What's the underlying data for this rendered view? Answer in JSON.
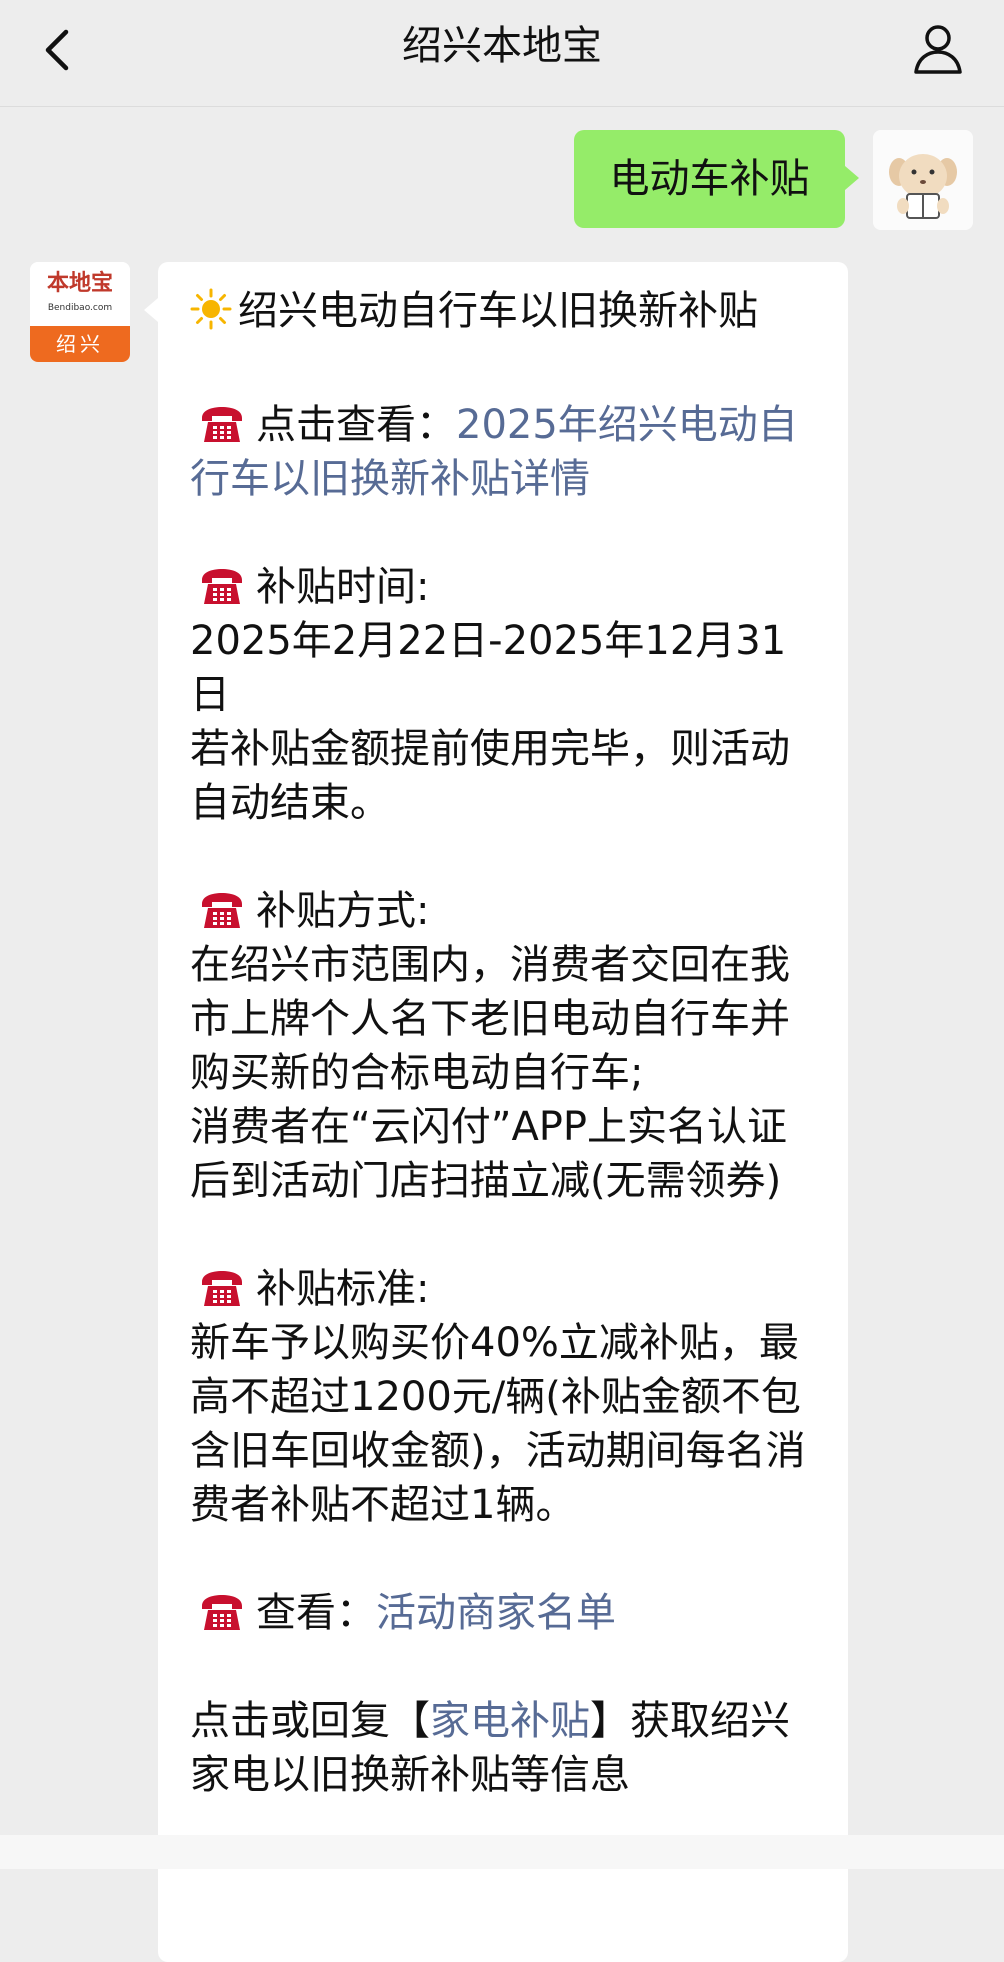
{
  "nav": {
    "title": "绍兴本地宝"
  },
  "outgoing_message": "电动车补贴",
  "bot_avatar": {
    "logo_text": "本地宝",
    "logo_sub": "Bendibao.com",
    "city": "绍兴"
  },
  "incoming": {
    "title": "绍兴电动自行车以旧换新补贴",
    "view_detail_prefix": "点击查看：",
    "view_detail_link": "2025年绍兴电动自行车以旧换新补贴详情",
    "time_heading": "补贴时间:",
    "time_text": "2025年2月22日-2025年12月31日",
    "time_note": "若补贴金额提前使用完毕，则活动自动结束。",
    "method_heading": "补贴方式:",
    "method_text_1": "在绍兴市范围内，消费者交回在我市上牌个人名下老旧电动自行车并购买新的合标电动自行车;",
    "method_text_2": "消费者在“云闪付”APP上实名认证后到活动门店扫描立减(无需领券)",
    "standard_heading": "补贴标准:",
    "standard_text": "新车予以购买价40%立减补贴，最高不超过1200元/辆(补贴金额不包含旧车回收金额)，活动期间每名消费者补贴不超过1辆。",
    "merchant_prefix": "查看：",
    "merchant_link": "活动商家名单",
    "reply_prefix": "点击或回复【",
    "reply_link": "家电补贴",
    "reply_suffix": "】获取绍兴家电以旧换新补贴等信息"
  },
  "colors": {
    "background": "#ededed",
    "outgoing_bubble": "#95ec69",
    "incoming_bubble": "#ffffff",
    "link": "#576b95",
    "bot_avatar_accent": "#ee6a1f"
  },
  "icons": {
    "back": "chevron-left-icon",
    "profile": "person-icon",
    "title_emoji": "sun-icon",
    "section_emoji": "telephone-icon"
  }
}
